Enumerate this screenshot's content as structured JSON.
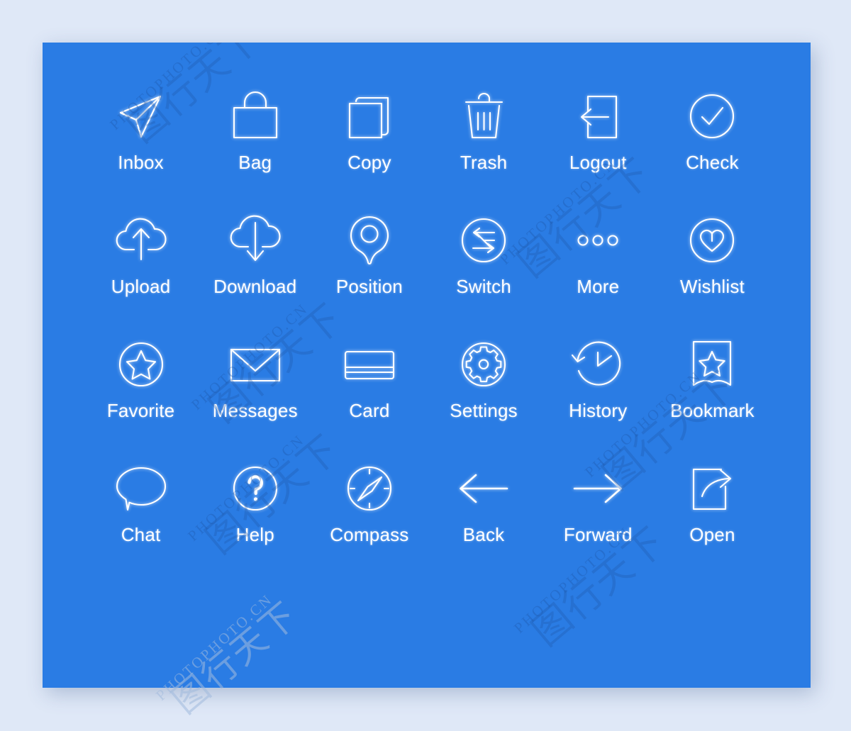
{
  "canvas": {
    "background_color": "#dfe8f7",
    "panel_color": "#2a7ce4",
    "icon_color": "#ffffff",
    "label_color": "#ffffff"
  },
  "watermark": {
    "latin": "PHOTOPHOTO.CN",
    "cjk": "图行天下",
    "color": "#1e55a5"
  },
  "icon_set": {
    "columns": 6,
    "rows": 4,
    "count": 24,
    "icons": [
      {
        "id": "inbox",
        "label": "Inbox",
        "glyph": "paper-plane-icon"
      },
      {
        "id": "bag",
        "label": "Bag",
        "glyph": "shopping-bag-icon"
      },
      {
        "id": "copy",
        "label": "Copy",
        "glyph": "copy-icon"
      },
      {
        "id": "trash",
        "label": "Trash",
        "glyph": "trash-icon"
      },
      {
        "id": "logout",
        "label": "Logout",
        "glyph": "logout-icon"
      },
      {
        "id": "check",
        "label": "Check",
        "glyph": "check-circle-icon"
      },
      {
        "id": "upload",
        "label": "Upload",
        "glyph": "cloud-upload-icon"
      },
      {
        "id": "download",
        "label": "Download",
        "glyph": "cloud-download-icon"
      },
      {
        "id": "position",
        "label": "Position",
        "glyph": "map-pin-icon"
      },
      {
        "id": "switch",
        "label": "Switch",
        "glyph": "switch-arrows-circle-icon"
      },
      {
        "id": "more",
        "label": "More",
        "glyph": "more-dots-icon"
      },
      {
        "id": "wishlist",
        "label": "Wishlist",
        "glyph": "heart-circle-icon"
      },
      {
        "id": "favorite",
        "label": "Favorite",
        "glyph": "star-circle-icon"
      },
      {
        "id": "messages",
        "label": "Messages",
        "glyph": "envelope-icon"
      },
      {
        "id": "card",
        "label": "Card",
        "glyph": "credit-card-icon"
      },
      {
        "id": "settings",
        "label": "Settings",
        "glyph": "gear-circle-icon"
      },
      {
        "id": "history",
        "label": "History",
        "glyph": "clock-rotate-icon"
      },
      {
        "id": "bookmark",
        "label": "Bookmark",
        "glyph": "bookmark-star-icon"
      },
      {
        "id": "chat",
        "label": "Chat",
        "glyph": "speech-bubble-icon"
      },
      {
        "id": "help",
        "label": "Help",
        "glyph": "question-circle-icon"
      },
      {
        "id": "compass",
        "label": "Compass",
        "glyph": "compass-icon"
      },
      {
        "id": "back",
        "label": "Back",
        "glyph": "arrow-left-icon"
      },
      {
        "id": "forward",
        "label": "Forward",
        "glyph": "arrow-right-icon"
      },
      {
        "id": "open",
        "label": "Open",
        "glyph": "open-external-icon"
      }
    ]
  }
}
